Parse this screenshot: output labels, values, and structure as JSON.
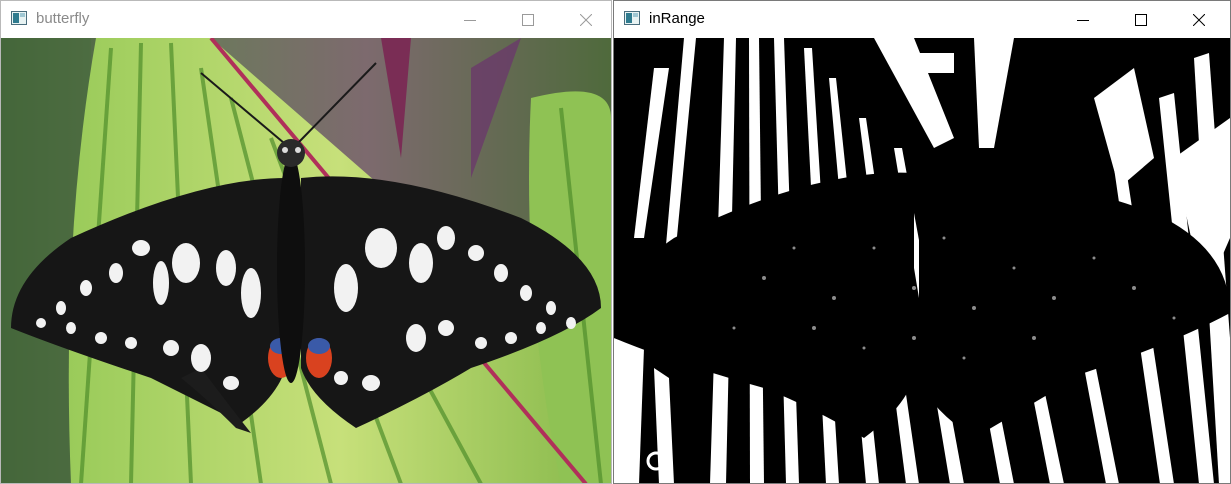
{
  "windows": [
    {
      "title": "butterfly",
      "active": false,
      "image": "color photo of black and white swallowtail butterfly on green striped leaf"
    },
    {
      "title": "inRange",
      "active": true,
      "image": "binary thresholded mask of the same butterfly photo"
    }
  ],
  "caption_buttons": {
    "minimize": "minimize-icon",
    "maximize": "maximize-icon",
    "close": "close-icon"
  },
  "colors": {
    "title_inactive": "#8a8a8a",
    "title_active": "#000000",
    "leaf_green": "#8cc24a",
    "mask_white": "#ffffff",
    "mask_black": "#000000"
  }
}
